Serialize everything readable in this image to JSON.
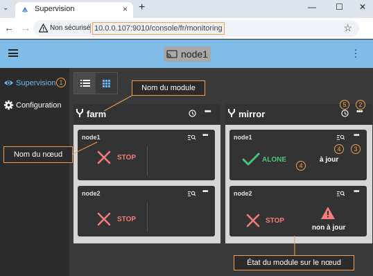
{
  "browser": {
    "tab_title": "Supervision",
    "tab_close": "×",
    "new_tab": "+",
    "insecure_label": "Non sécurisé",
    "url": "10.0.0.107:9010/console/fr/monitoring",
    "win_minimize": "—",
    "win_maximize": "☐",
    "win_close": "✕",
    "star": "☆",
    "back": "←",
    "forward": "→"
  },
  "appbar": {
    "node_title": "node1"
  },
  "sidebar": {
    "items": [
      {
        "label": "Supervision",
        "icon": "eye-icon",
        "active": true
      },
      {
        "label": "Configuration",
        "icon": "gear-icon",
        "active": false
      }
    ]
  },
  "view_toggle": {
    "options": [
      {
        "icon": "list-icon",
        "active": true
      },
      {
        "icon": "grid-icon",
        "active": false
      }
    ]
  },
  "modules": [
    {
      "name": "farm",
      "nodes": [
        {
          "name": "node1",
          "state_icon": "cross-icon",
          "state": "STOP",
          "sync": ""
        },
        {
          "name": "node2",
          "state_icon": "cross-icon",
          "state": "STOP",
          "sync": ""
        }
      ]
    },
    {
      "name": "mirror",
      "nodes": [
        {
          "name": "node1",
          "state_icon": "check-icon",
          "state": "ALONE",
          "sync": "à jour"
        },
        {
          "name": "node2",
          "state_icon": "cross-icon",
          "state": "STOP",
          "sync": "non à jour"
        }
      ]
    }
  ],
  "annotations": {
    "module_name": "Nom du module",
    "node_name": "Nom du nœud",
    "module_state": "État du module sur le nœud",
    "numbers": [
      "1",
      "2",
      "3",
      "4",
      "4",
      "5"
    ]
  },
  "colors": {
    "appbar": "#7fbde8",
    "accent_blue": "#6ab8f0",
    "stop_red": "#f47c7c",
    "alone_green": "#4cc47c",
    "annotation_orange": "#f0a050"
  }
}
